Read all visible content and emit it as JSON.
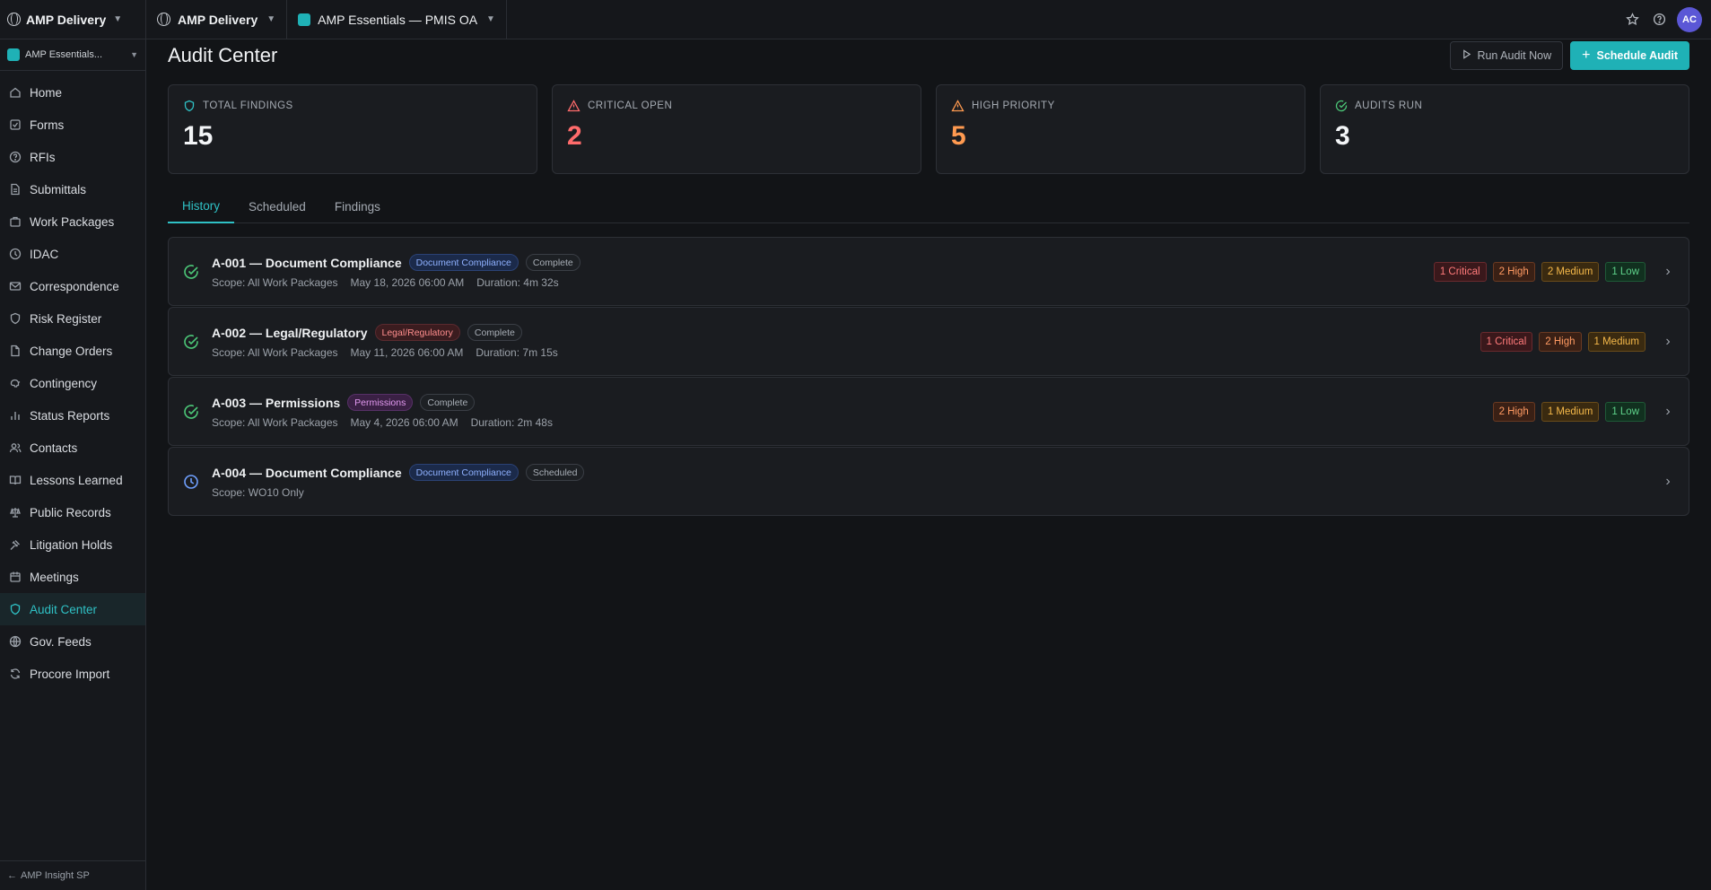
{
  "app": {
    "org": "AMP Delivery",
    "project_short": "AMP Essentials...",
    "back_link": "AMP Insight SP"
  },
  "topbar": {
    "org": "AMP Delivery",
    "project": "AMP Essentials — PMIS OA",
    "avatar": "AC"
  },
  "sidebar": {
    "items": [
      {
        "label": "Home",
        "icon": "home-icon"
      },
      {
        "label": "Forms",
        "icon": "forms-icon"
      },
      {
        "label": "RFIs",
        "icon": "help-circle-icon"
      },
      {
        "label": "Submittals",
        "icon": "file-icon"
      },
      {
        "label": "Work Packages",
        "icon": "package-icon"
      },
      {
        "label": "IDAC",
        "icon": "info-circle-icon"
      },
      {
        "label": "Correspondence",
        "icon": "mail-icon"
      },
      {
        "label": "Risk Register",
        "icon": "shield-icon"
      },
      {
        "label": "Change Orders",
        "icon": "document-icon"
      },
      {
        "label": "Contingency",
        "icon": "piggy-bank-icon"
      },
      {
        "label": "Status Reports",
        "icon": "bar-chart-icon"
      },
      {
        "label": "Contacts",
        "icon": "users-icon"
      },
      {
        "label": "Lessons Learned",
        "icon": "book-icon"
      },
      {
        "label": "Public Records",
        "icon": "scale-icon"
      },
      {
        "label": "Litigation Holds",
        "icon": "gavel-icon"
      },
      {
        "label": "Meetings",
        "icon": "calendar-icon"
      },
      {
        "label": "Audit Center",
        "icon": "shield-icon",
        "active": true
      },
      {
        "label": "Gov. Feeds",
        "icon": "globe-icon"
      },
      {
        "label": "Procore Import",
        "icon": "refresh-icon"
      }
    ]
  },
  "page": {
    "title": "Audit Center",
    "run_label": "Run Audit Now",
    "schedule_label": "Schedule Audit"
  },
  "stats": [
    {
      "label": "TOTAL FINDINGS",
      "value": "15",
      "color": "#f3f5f7",
      "icon": "shield-icon"
    },
    {
      "label": "CRITICAL OPEN",
      "value": "2",
      "color": "#ff6b6b",
      "icon": "alert-triangle-icon"
    },
    {
      "label": "HIGH PRIORITY",
      "value": "5",
      "color": "#ff9a50",
      "icon": "alert-triangle-icon"
    },
    {
      "label": "AUDITS RUN",
      "value": "3",
      "color": "#f3f5f7",
      "icon": "check-circle-icon"
    }
  ],
  "tabs": [
    "History",
    "Scheduled",
    "Findings"
  ],
  "audits": [
    {
      "title": "A-001 — Document Compliance",
      "category": "Document Compliance",
      "status": "Complete",
      "scope": "Scope: All Work Packages",
      "date": "May 18, 2026 06:00 AM",
      "duration": "Duration: 4m 32s",
      "sev": [
        "1 Critical",
        "2 High",
        "2 Medium",
        "1 Low"
      ]
    },
    {
      "title": "A-002 — Legal/Regulatory",
      "category": "Legal/Regulatory",
      "status": "Complete",
      "scope": "Scope: All Work Packages",
      "date": "May 11, 2026 06:00 AM",
      "duration": "Duration: 7m 15s",
      "sev": [
        "1 Critical",
        "2 High",
        "1 Medium"
      ]
    },
    {
      "title": "A-003 — Permissions",
      "category": "Permissions",
      "status": "Complete",
      "scope": "Scope: All Work Packages",
      "date": "May 4, 2026 06:00 AM",
      "duration": "Duration: 2m 48s",
      "sev": [
        "2 High",
        "1 Medium",
        "1 Low"
      ]
    },
    {
      "title": "A-004 — Document Compliance",
      "category": "Document Compliance",
      "status": "Scheduled",
      "scope": "Scope: WO10 Only"
    }
  ]
}
